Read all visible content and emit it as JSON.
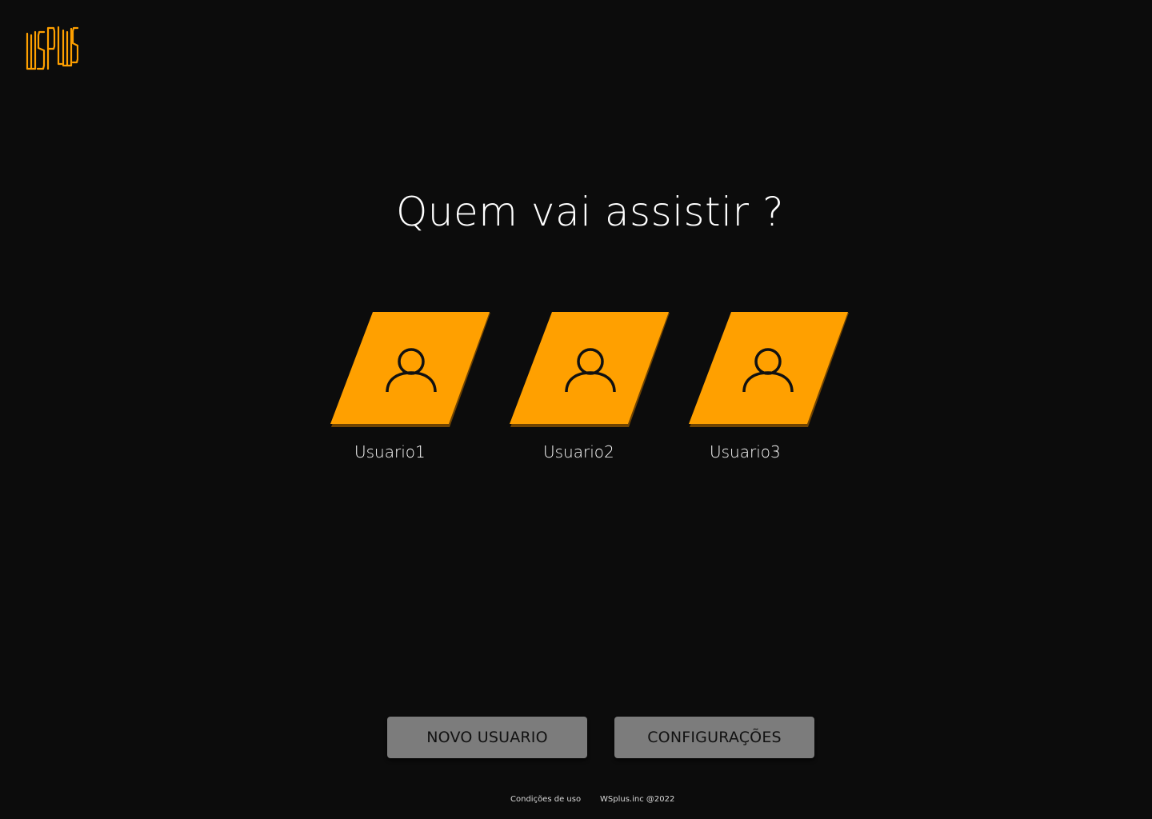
{
  "brand": {
    "logo_text": "WSPLUS",
    "accent_color": "#ffa000",
    "background_color": "#0c0c0c"
  },
  "title": "Quem vai assistir ?",
  "profiles": [
    {
      "name": "Usuario1",
      "icon": "user-icon"
    },
    {
      "name": "Usuario2",
      "icon": "user-icon"
    },
    {
      "name": "Usuario3",
      "icon": "user-icon"
    }
  ],
  "buttons": {
    "new_user": "NOVO USUARIO",
    "settings": "CONFIGURAÇÕES"
  },
  "footer": {
    "terms": "Condições de uso",
    "copyright": "WSplus.inc @2022"
  }
}
